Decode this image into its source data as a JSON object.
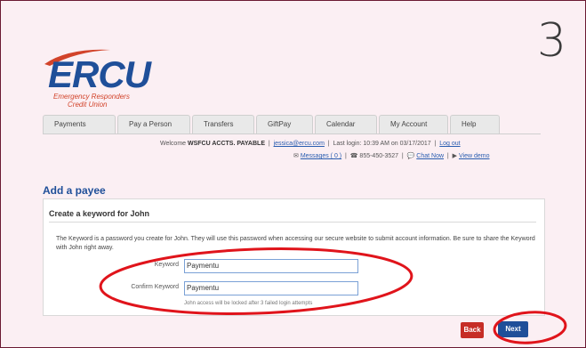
{
  "step_number": "3",
  "logo": {
    "brand": "ERCU",
    "tagline_line1": "Emergency Responders",
    "tagline_line2": "Credit Union"
  },
  "tabs": [
    "Payments",
    "Pay a Person",
    "Transfers",
    "GiftPay",
    "Calendar",
    "My Account",
    "Help"
  ],
  "header": {
    "welcome_prefix": "Welcome",
    "username": "WSFCU ACCTS. PAYABLE",
    "email": "jessica@ercu.com",
    "last_login": "Last login: 10:39 AM on 03/17/2017",
    "logout": "Log out",
    "messages": "Messages ( 0 )",
    "phone": "855-450-3527",
    "chat": "Chat Now",
    "demo": "View demo"
  },
  "page": {
    "title": "Add a payee",
    "section_heading": "Create a keyword for John",
    "description": "The Keyword is a password you create for John. They will use this password when accessing our secure website to submit account information. Be sure to share the Keyword with John right away."
  },
  "form": {
    "keyword_label": "Keyword",
    "keyword_value": "Paymentu",
    "confirm_label": "Confirm Keyword",
    "confirm_value": "Paymentu",
    "lockout_hint": "John access will be locked after 3 failed login attempts"
  },
  "buttons": {
    "back": "Back",
    "next": "Next"
  },
  "colors": {
    "accent_blue": "#1f4f99",
    "annotation_red": "#e0141b",
    "background": "#fbeff3"
  }
}
